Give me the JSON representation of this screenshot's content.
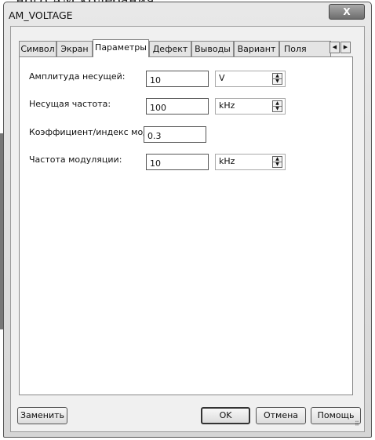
{
  "top_snippet": "ного АМ колебания.",
  "window": {
    "title": "AM_VOLTAGE",
    "close_label": "X"
  },
  "tabs": [
    {
      "label": "Символ"
    },
    {
      "label": "Экран"
    },
    {
      "label": "Параметры"
    },
    {
      "label": "Дефект"
    },
    {
      "label": "Выводы"
    },
    {
      "label": "Вариант"
    },
    {
      "label": "Поля"
    }
  ],
  "tab_scroll": {
    "left": "◀",
    "right": "▶"
  },
  "params": [
    {
      "label": "Амплитуда несущей:",
      "value": "10",
      "unit": "V"
    },
    {
      "label": "Несущая частота:",
      "value": "100",
      "unit": "kHz"
    },
    {
      "label": "Коэффициент/индекс модуляции:",
      "value": "0.3"
    },
    {
      "label": "Частота модуляции:",
      "value": "10",
      "unit": "kHz"
    }
  ],
  "spin_arrows": {
    "up": "▲",
    "down": "▼"
  },
  "buttons": {
    "replace": "Заменить",
    "ok": "OK",
    "cancel": "Отмена",
    "help": "Помощь"
  }
}
